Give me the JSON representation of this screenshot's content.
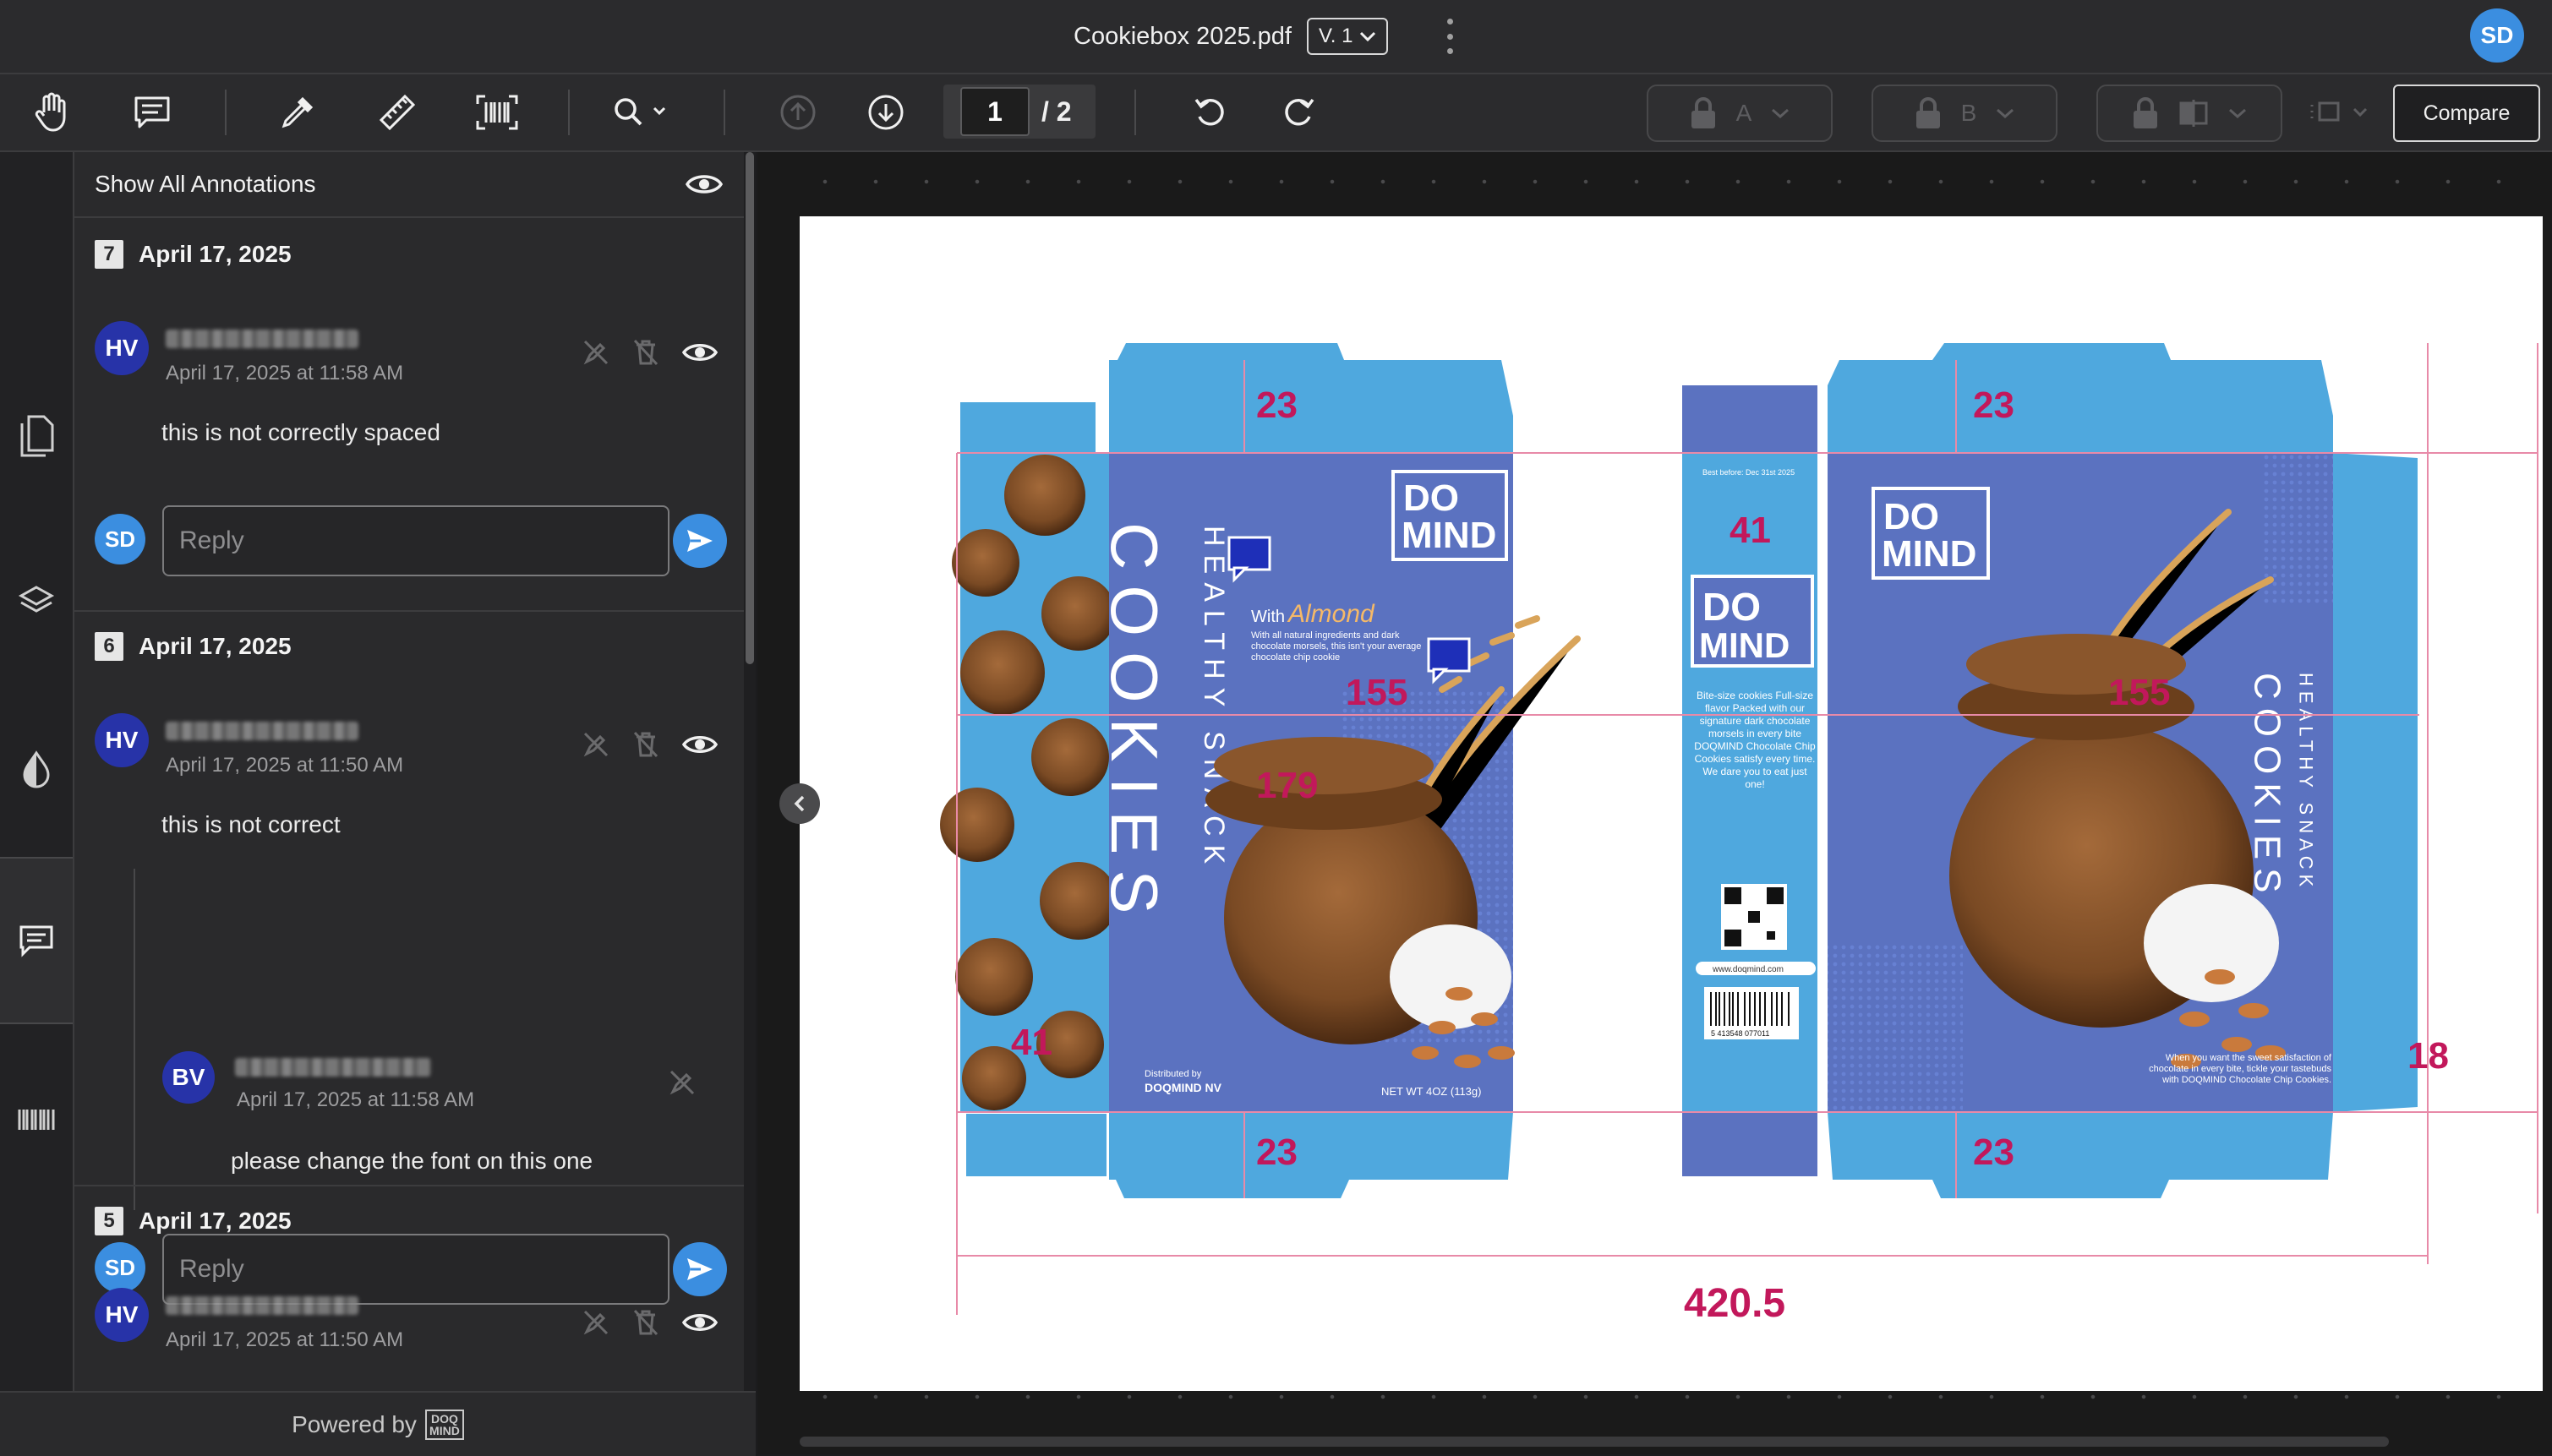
{
  "titlebar": {
    "file_name": "Cookiebox 2025.pdf",
    "version": "V. 1",
    "user_initials": "SD"
  },
  "toolbar": {
    "current_page": "1",
    "total_pages": "/ 2",
    "compare_label": "Compare",
    "lock_a_label": "A",
    "lock_b_label": "B",
    "icons": [
      "hand-icon",
      "comment-icon",
      "eyedropper-icon",
      "ruler-icon",
      "barcode-scan-icon",
      "zoom-icon",
      "upload-icon",
      "download-icon",
      "rotate-left-icon",
      "rotate-right-icon"
    ]
  },
  "panel": {
    "header_label": "Show All Annotations",
    "reply_placeholder": "Reply",
    "footer_label": "Powered by",
    "footer_logo": "DOQ MIND",
    "groups": [
      {
        "number": "7",
        "date": "April 17, 2025",
        "author_initials": "HV",
        "timestamp": "April 17, 2025 at 11:58 AM",
        "comment": "this is not correctly spaced",
        "reply_initials": "SD"
      },
      {
        "number": "6",
        "date": "April 17, 2025",
        "author_initials": "HV",
        "timestamp": "April 17, 2025 at 11:50 AM",
        "comment": "this is not correct",
        "reply": {
          "author_initials": "BV",
          "timestamp": "April 17, 2025 at 11:58 AM",
          "comment": "please change the font on this one"
        },
        "reply_initials": "SD"
      },
      {
        "number": "5",
        "date": "April 17, 2025",
        "author_initials": "HV",
        "timestamp": "April 17, 2025 at 11:50 AM"
      }
    ]
  },
  "document": {
    "dimensions": {
      "top_flap_left": "23",
      "top_flap_right": "23",
      "bottom_flap_left": "23",
      "bottom_flap_right": "23",
      "side_top": "41",
      "side_left": "41",
      "glue_right": "18",
      "front_height": "179",
      "front_width": "155",
      "back_width": "155",
      "total_width": "420.5"
    },
    "artwork": {
      "brand_line1": "DO",
      "brand_line2": "MIND",
      "product_main": "COOKIES",
      "product_sub": "HEALTHY SNACK",
      "flavor_prefix": "With",
      "flavor": "Almond",
      "tagline": "With all natural ingredients and dark chocolate morsels, this isn't your average chocolate chip cookie",
      "distributor_label": "Distributed by",
      "distributor": "DOQMIND NV",
      "net_weight": "NET WT 4OZ (113g)",
      "best_before": "Best before: Dec 31st 2025",
      "side_copy": "Bite-size cookies Full-size flavor Packed with our signature dark chocolate morsels in every bite DOQMIND Chocolate Chip Cookies satisfy every time. We dare you to eat just one!",
      "website": "www.doqmind.com",
      "barcode_number": "5 413548 077011",
      "back_copy": "When you want the sweet satisfaction of chocolate in every bite, tickle your tastebuds with DOQMIND Chocolate Chip Cookies."
    },
    "colors": {
      "box_light_blue": "#4fa8de",
      "box_panel_blue": "#5b72c0",
      "dimension_magenta": "#c2185b",
      "pin_blue": "#1e2fb8"
    }
  }
}
